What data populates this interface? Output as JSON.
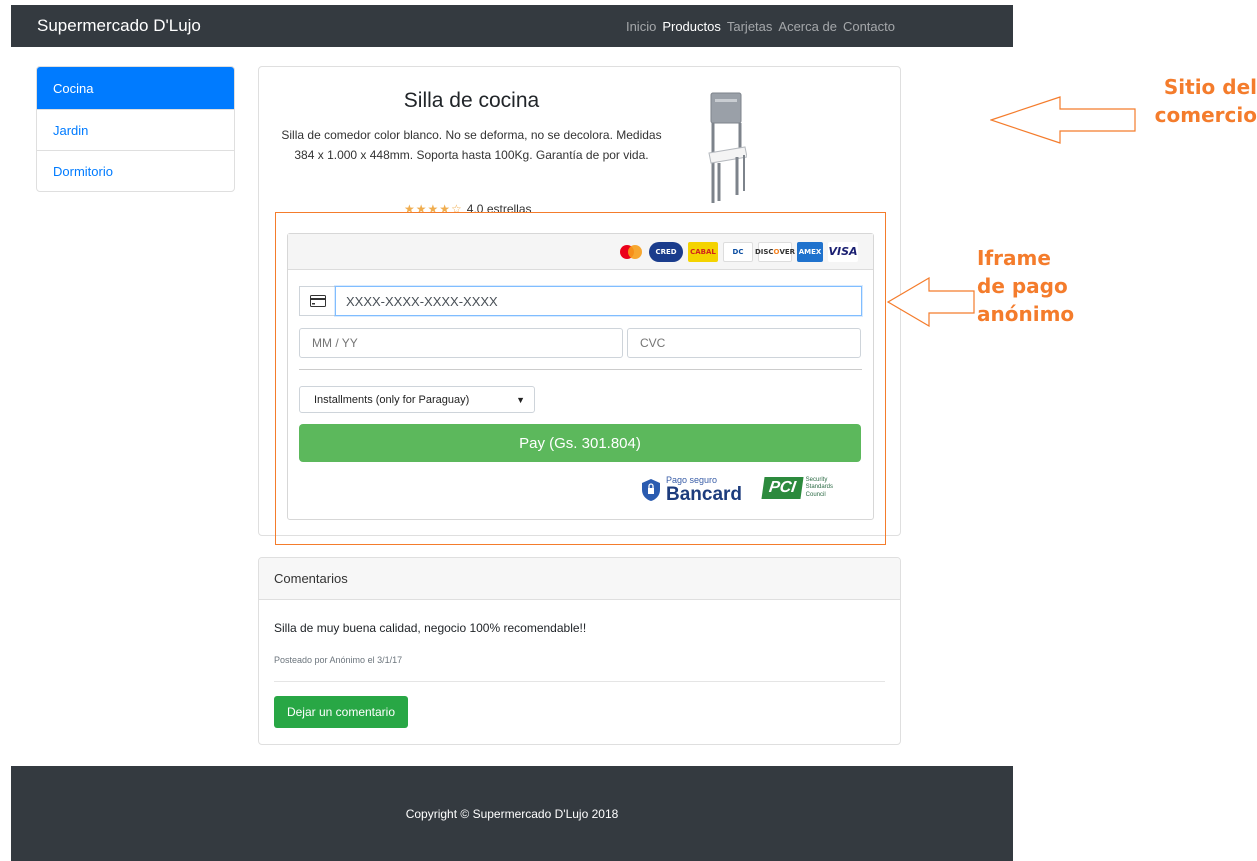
{
  "navbar": {
    "brand": "Supermercado D'Lujo",
    "links": [
      {
        "label": "Inicio",
        "active": false
      },
      {
        "label": "Productos",
        "active": true
      },
      {
        "label": "Tarjetas",
        "active": false
      },
      {
        "label": "Acerca de",
        "active": false
      },
      {
        "label": "Contacto",
        "active": false
      }
    ]
  },
  "sidebar": {
    "items": [
      {
        "label": "Cocina",
        "active": true
      },
      {
        "label": "Jardin",
        "active": false
      },
      {
        "label": "Dormitorio",
        "active": false
      }
    ]
  },
  "product": {
    "title": "Silla de cocina",
    "description": "Silla de comedor color blanco. No se deforma, no se decolora. Medidas 384 x 1.000 x 448mm. Soporta hasta 100Kg. Garantía de por vida.",
    "stars_display": "★★★★☆",
    "rating_value": 4,
    "rating_text": "4.0 estrellas"
  },
  "payment": {
    "card_brands": [
      "mastercard",
      "credifielco",
      "cabal",
      "diners-club",
      "discover",
      "american-express",
      "visa"
    ],
    "card_number_value": "XXXX-XXXX-XXXX-XXXX",
    "expiry_placeholder": "MM / YY",
    "cvc_placeholder": "CVC",
    "installments_label": "Installments (only for Paraguay)",
    "pay_button_label": "Pay (Gs. 301.804)",
    "bancard_small": "Pago seguro",
    "bancard_big": "Bancard",
    "pci_logo": "PCI",
    "pci_sub": "Security Standards Council"
  },
  "comments": {
    "header": "Comentarios",
    "items": [
      {
        "text": "Silla de muy buena calidad, negocio 100% recomendable!!",
        "meta": "Posteado por Anónimo el 3/1/17"
      }
    ],
    "leave_comment_label": "Dejar un comentario"
  },
  "footer": {
    "copyright": "Copyright © Supermercado D'Lujo 2018"
  },
  "annotations": {
    "site_line1": "Sitio del",
    "site_line2": "comercio",
    "iframe_line1": "Iframe",
    "iframe_line2": "de pago",
    "iframe_line3": "anónimo",
    "color": "#f47c2c"
  },
  "colors": {
    "navbar_bg": "#343a40",
    "primary": "#007bff",
    "pay_green": "#5cb85c",
    "comment_green": "#28a745",
    "annotation_orange": "#f47c2c"
  }
}
